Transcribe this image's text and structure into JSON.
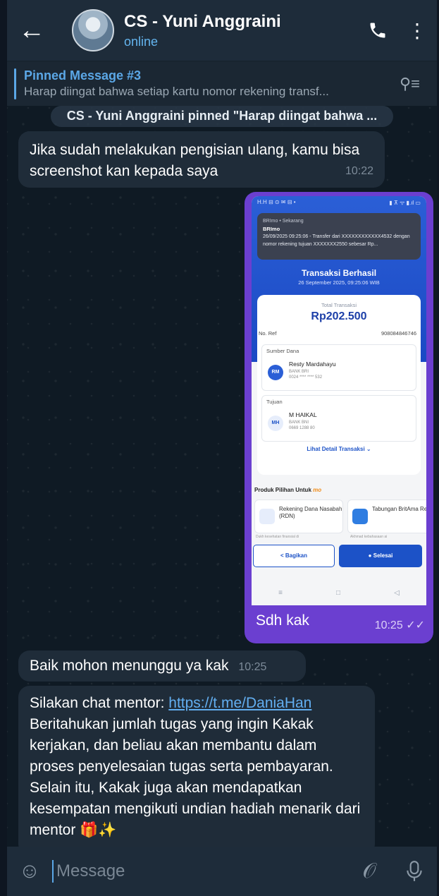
{
  "header": {
    "title": "CS - Yuni Anggraini",
    "status": "online"
  },
  "pinned": {
    "title": "Pinned Message #3",
    "body": "Harap diingat bahwa setiap kartu nomor rekening transf..."
  },
  "service_message": "CS - Yuni Anggraini pinned \"Harap diingat bahwa ...",
  "messages": [
    {
      "text": "Jika sudah melakukan pengisian ulang, kamu bisa screenshot kan kepada saya",
      "time": "10:22"
    },
    {
      "text": "Baik mohon menunggu ya kak",
      "time": "10:25"
    }
  ],
  "media_message": {
    "caption": "Sdh kak",
    "time": "10:25",
    "read_icon": "double-check-icon",
    "screenshot": {
      "status_left": "H.H ⊟ ⊙ ✉ ⊟ •",
      "status_right": "▮ ⊼ ᯤ ▮.ıl ▭",
      "notif_app": "BRImo • Sekarang",
      "notif_title": "BRImo",
      "notif_body": "26/09/2025 09:25:06 - Transfer dari XXXXXXXXXXXX4532 dengan nomor rekening tujuan XXXXXXX2550 sebesar Rp...",
      "title": "Transaksi Berhasil",
      "date": "26 September 2025, 09:25:06 WIB",
      "total_label": "Total Transaksi",
      "total_value": "Rp202.500",
      "noref_label": "No. Ref",
      "noref_value": "908084846746",
      "source_label": "Sumber Dana",
      "source_initials": "RM",
      "source_name": "Resty Mardahayu",
      "source_bank": "BANK BRI",
      "source_acct": "0024 **** **** 532",
      "dest_label": "Tujuan",
      "dest_initials": "MH",
      "dest_name": "M HAIKAL",
      "dest_bank": "BANK BNI",
      "dest_acct": "0669 1288 80",
      "detail_link": "Lihat Detail Transaksi ⌄",
      "products_title": "Produk Pilihan Untuk",
      "products_brand": "mo",
      "product1": "Rekening Dana Nasabah (RDN)",
      "product1_caption": "Dukh kesehatan finansial di",
      "product2": "Tabungan BritAma Re",
      "product2_caption": "Akhmad kebahasaan ai",
      "share_button": "Bagikan",
      "done_button": "Selesai"
    }
  },
  "mentor_message": {
    "prefix": "Silakan chat mentor: ",
    "link": "https://t.me/DaniaHan",
    "body": "Beritahukan jumlah tugas yang ingin Kakak kerjakan, dan beliau akan membantu dalam proses penyelesaian tugas serta pembayaran.",
    "body2": "Selain itu, Kakak juga akan mendapatkan kesempatan mengikuti undian hadiah menarik dari mentor 🎁✨"
  },
  "input": {
    "placeholder": "Message"
  },
  "colors": {
    "header_bg": "#1e2c3a",
    "chat_bg": "#0f1a24",
    "incoming_bubble": "#1f2c39",
    "outgoing_bubble": "#6b3fd0",
    "accent": "#5ba7e6"
  }
}
